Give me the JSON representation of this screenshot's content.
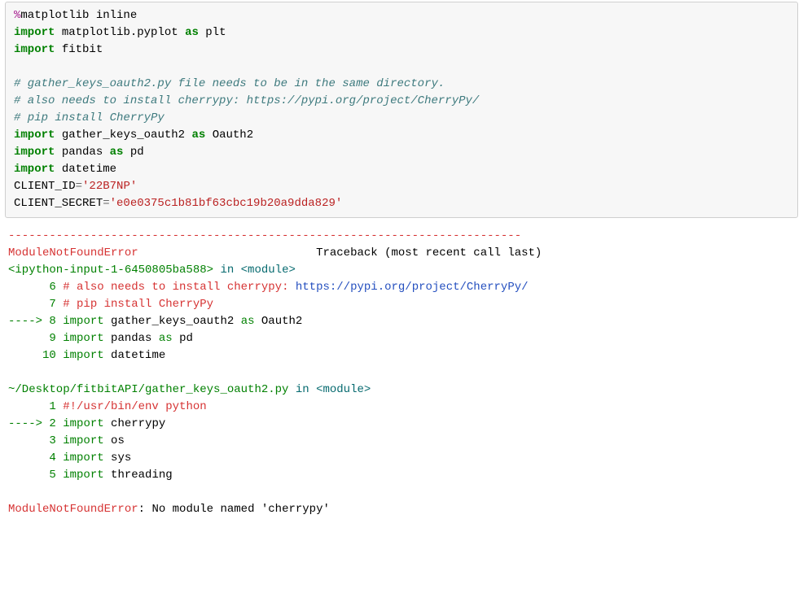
{
  "code": {
    "l1_magic": "%",
    "l1_rest": "matplotlib inline",
    "import_kw": "import",
    "as_kw": "as",
    "l2_mod": "matplotlib.pyplot",
    "l2_alias": "plt",
    "l3_mod": "fitbit",
    "l5_cm": "# gather_keys_oauth2.py file needs to be in the same directory.",
    "l6_cm": "# also needs to install cherrypy: https://pypi.org/project/CherryPy/",
    "l7_cm": "# pip install CherryPy",
    "l8_mod": "gather_keys_oauth2",
    "l8_alias": "Oauth2",
    "l9_mod": "pandas",
    "l9_alias": "pd",
    "l10_mod": "datetime",
    "l11_var": "CLIENT_ID",
    "l11_eq": "=",
    "l11_val": "'22B7NP'",
    "l12_var": "CLIENT_SECRET",
    "l12_eq": "=",
    "l12_val": "'e0e0375c1b81bf63cbc19b20a9dda829'"
  },
  "err": {
    "sep": "---------------------------------------------------------------------------",
    "exc_name": "ModuleNotFoundError",
    "tb_label": "Traceback (most recent call last)",
    "frame1_loc": "<ipython-input-1-6450805ba588>",
    "in_kw": " in ",
    "module_tag": "<module>",
    "f1_l6_num": "      6 ",
    "f1_l6_a": "# also needs to install cherrypy: ",
    "f1_l6_b": "https://pypi.org/project/CherryPy/",
    "f1_l7_num": "      7 ",
    "f1_l7": "# pip install CherryPy",
    "arrow": "----> ",
    "f1_l8_num": "8 ",
    "f1_l8_kw1": "import",
    "f1_l8_mod": " gather_keys_oauth2 ",
    "f1_l8_kw2": "as",
    "f1_l8_alias": " Oauth2",
    "f1_l9_num": "      9 ",
    "f1_l9_kw1": "import",
    "f1_l9_mod": " pandas ",
    "f1_l9_kw2": "as",
    "f1_l9_alias": " pd",
    "f1_l10_num": "     10 ",
    "f1_l10_kw": "import",
    "f1_l10_mod": " datetime",
    "frame2_loc": "~/Desktop/fitbitAPI/gather_keys_oauth2.py",
    "f2_l1_num": "      1 ",
    "f2_l1": "#!/usr/bin/env python",
    "f2_l2_num": "2 ",
    "f2_l2_kw": "import",
    "f2_l2_mod": " cherrypy",
    "f2_l3_num": "      3 ",
    "f2_l3_kw": "import",
    "f2_l3_mod": " os",
    "f2_l4_num": "      4 ",
    "f2_l4_kw": "import",
    "f2_l4_mod": " sys",
    "f2_l5_num": "      5 ",
    "f2_l5_kw": "import",
    "f2_l5_mod": " threading",
    "final_exc": "ModuleNotFoundError",
    "final_msg": ": No module named 'cherrypy'"
  },
  "spacing": {
    "tb_gap": "                          "
  }
}
